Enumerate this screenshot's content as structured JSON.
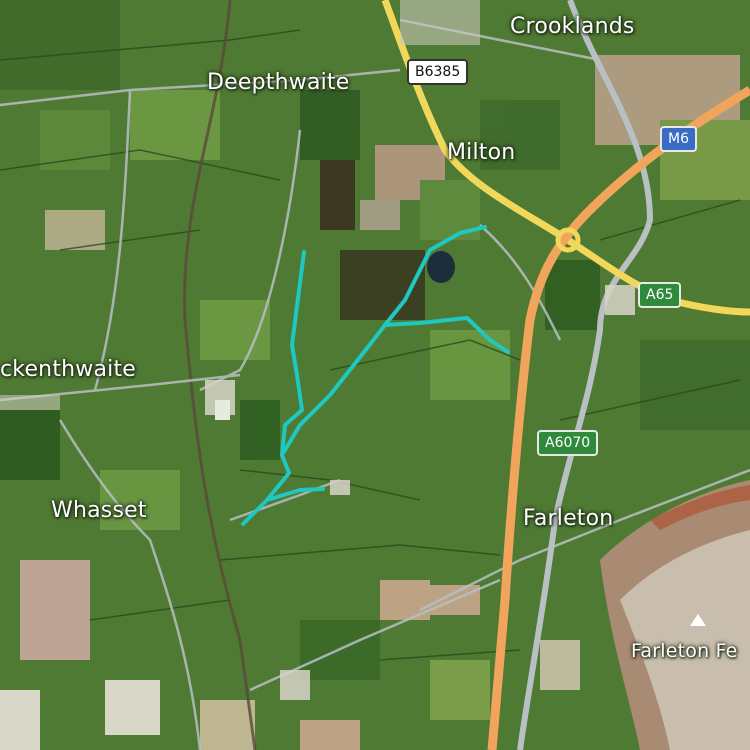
{
  "map": {
    "type": "satellite",
    "colors": {
      "route": "#1fc8c0",
      "motorway": "#f1a45c",
      "a_road": "#f2d85a",
      "minor_road": "#b8c0c4",
      "field_dark": "#3f6a2b",
      "field_light": "#6f9a44"
    }
  },
  "places": {
    "crooklands": "Crooklands",
    "deepthwaite": "Deepthwaite",
    "milton": "Milton",
    "ickenthwaite": "ckenthwaite",
    "whasset": "Whasset",
    "farleton": "Farleton",
    "farleton_fell": "Farleton Fe"
  },
  "roads": {
    "b6385": "B6385",
    "m6": "M6",
    "a65": "A65",
    "a6070": "A6070"
  },
  "icons": {
    "peak": "mountain-peak-icon"
  }
}
